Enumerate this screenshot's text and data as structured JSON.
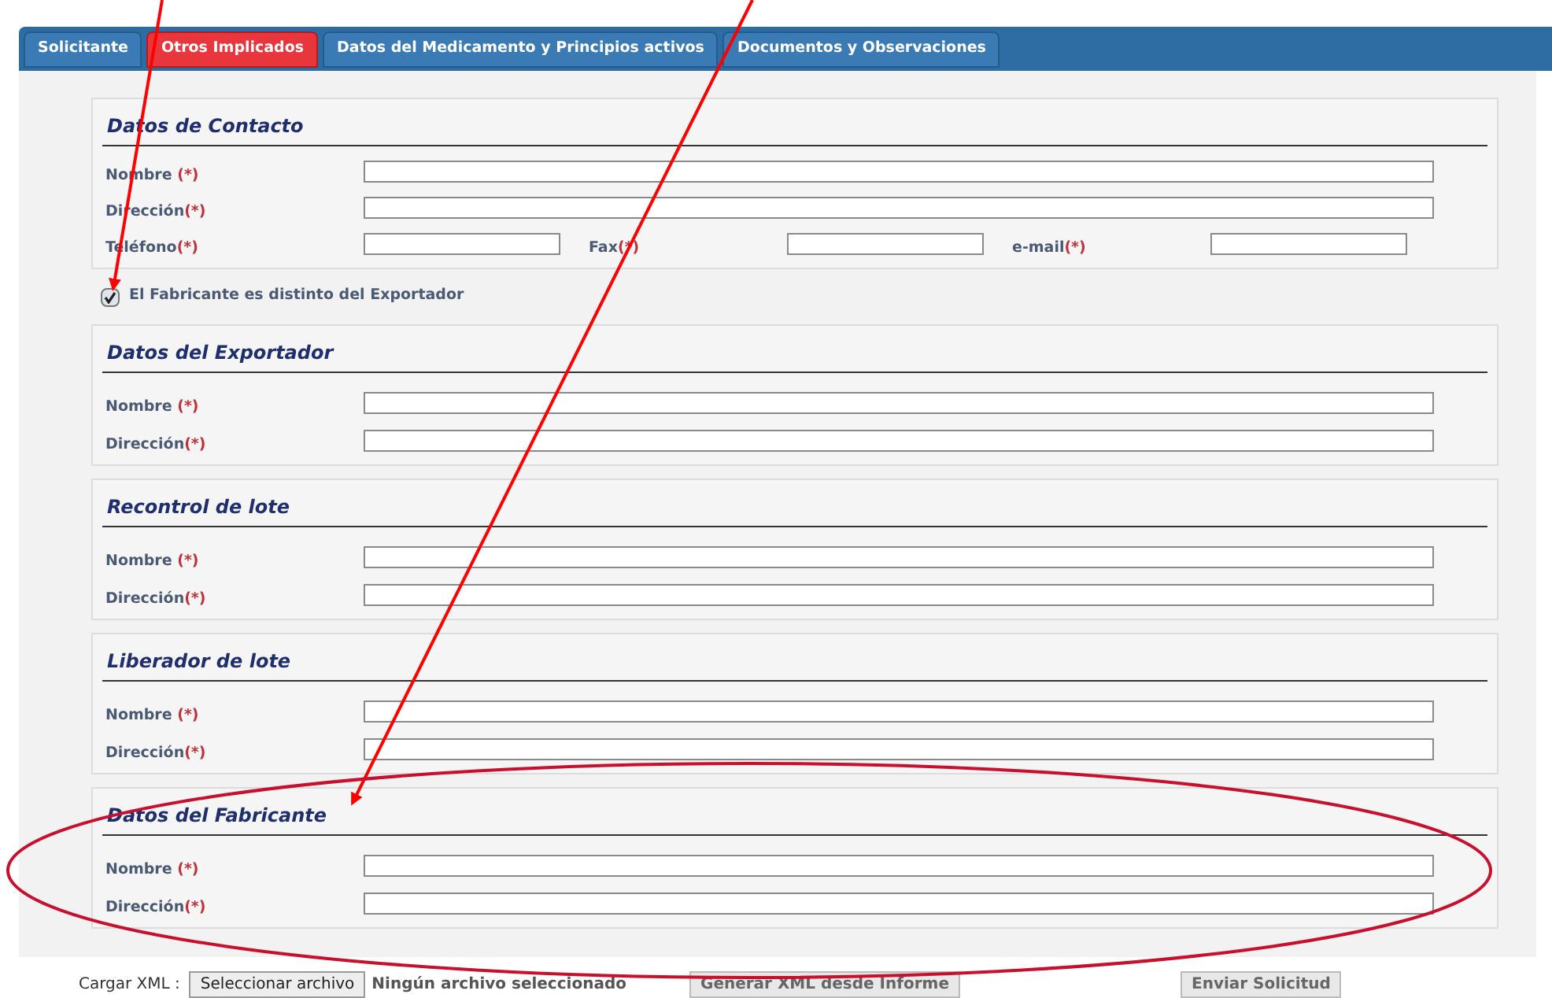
{
  "tabs": [
    {
      "label": "Solicitante",
      "selected": false
    },
    {
      "label": "Otros Implicados",
      "selected": true
    },
    {
      "label": "Datos del Medicamento y Principios activos",
      "selected": false
    },
    {
      "label": "Documentos y Observaciones",
      "selected": false
    }
  ],
  "sections": [
    {
      "kind": "section",
      "title": "Datos de Contacto",
      "rows": [
        [
          {
            "label": "Nombre ",
            "marker": "(*)"
          }
        ],
        [
          {
            "label": "Dirección",
            "marker": "(*)"
          }
        ],
        [
          {
            "label": "Teléfono",
            "marker": "(*)"
          },
          {
            "label": "Fax",
            "marker": "(*)"
          },
          {
            "label": "e-mail",
            "marker": "(*)"
          }
        ]
      ]
    },
    {
      "kind": "checkbox",
      "label": "El Fabricante es distinto del Exportador",
      "checked": true
    },
    {
      "kind": "section",
      "title": "Datos del Exportador",
      "rows": [
        [
          {
            "label": "Nombre ",
            "marker": "(*)"
          }
        ],
        [
          {
            "label": "Dirección",
            "marker": "(*)"
          }
        ]
      ]
    },
    {
      "kind": "section",
      "title": "Recontrol de lote",
      "rows": [
        [
          {
            "label": "Nombre ",
            "marker": "(*)"
          }
        ],
        [
          {
            "label": "Dirección",
            "marker": "(*)"
          }
        ]
      ]
    },
    {
      "kind": "section",
      "title": "Liberador de lote",
      "rows": [
        [
          {
            "label": "Nombre ",
            "marker": "(*)"
          }
        ],
        [
          {
            "label": "Dirección",
            "marker": "(*)"
          }
        ]
      ]
    },
    {
      "kind": "section",
      "title": "Datos del Fabricante",
      "rows": [
        [
          {
            "label": "Nombre ",
            "marker": "(*)"
          }
        ],
        [
          {
            "label": "Dirección",
            "marker": "(*)"
          }
        ]
      ]
    }
  ],
  "footer": {
    "upload_label": "Cargar XML :",
    "choose_button": "Seleccionar archivo",
    "no_file": "Ningún archivo seleccionado",
    "generate_button": "Generar XML desde Informe",
    "send_button": "Enviar Solicitud"
  }
}
